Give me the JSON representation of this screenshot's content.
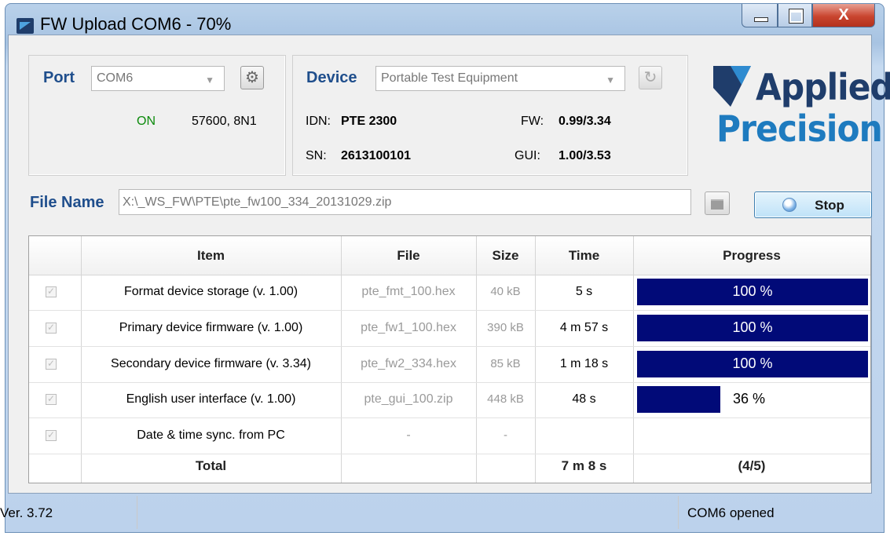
{
  "window": {
    "title": "FW Upload COM6 - 70%",
    "close_glyph": "X"
  },
  "port": {
    "label": "Port",
    "selected": "COM6",
    "status": "ON",
    "settings": "57600, 8N1"
  },
  "device": {
    "label": "Device",
    "selected": "Portable Test Equipment",
    "idn_label": "IDN:",
    "idn_value": "PTE 2300",
    "sn_label": "SN:",
    "sn_value": "2613100101",
    "fw_label": "FW:",
    "fw_value": "0.99/3.34",
    "gui_label": "GUI:",
    "gui_value": "1.00/3.53"
  },
  "logo": {
    "line1": "Applied",
    "line2": "Precision"
  },
  "file": {
    "label": "File Name",
    "path": "X:\\_WS_FW\\PTE\\pte_fw100_334_20131029.zip"
  },
  "stop_label": "Stop",
  "table": {
    "headers": [
      "Item",
      "File",
      "Size",
      "Time",
      "Progress"
    ],
    "rows": [
      {
        "item": "Format device storage (v. 1.00)",
        "file": "pte_fmt_100.hex",
        "size": "40 kB",
        "time": "5 s",
        "progress": 100,
        "progress_text": "100 %"
      },
      {
        "item": "Primary device firmware (v. 1.00)",
        "file": "pte_fw1_100.hex",
        "size": "390 kB",
        "time": "4 m 57 s",
        "progress": 100,
        "progress_text": "100 %"
      },
      {
        "item": "Secondary device firmware (v. 3.34)",
        "file": "pte_fw2_334.hex",
        "size": "85 kB",
        "time": "1 m 18 s",
        "progress": 100,
        "progress_text": "100 %"
      },
      {
        "item": "English user interface (v. 1.00)",
        "file": "pte_gui_100.zip",
        "size": "448 kB",
        "time": "48 s",
        "progress": 36,
        "progress_text": "36 %"
      },
      {
        "item": "Date & time sync. from PC",
        "file": "-",
        "size": "-",
        "time": "",
        "progress": 0,
        "progress_text": ""
      }
    ],
    "total": {
      "label": "Total",
      "time": "7 m 8 s",
      "progress": "(4/5)"
    }
  },
  "statusbar": {
    "version": "Ver. 3.72",
    "message": "COM6 opened"
  },
  "colors": {
    "accent_blue": "#1f4e8c",
    "progress_fill": "#010a78",
    "on_green": "#0b8a0b"
  },
  "icons": {
    "gear": "gear-icon",
    "refresh": "refresh-icon",
    "folder": "folder-icon",
    "stop": "stop-icon",
    "check": "checkbox-icon"
  }
}
